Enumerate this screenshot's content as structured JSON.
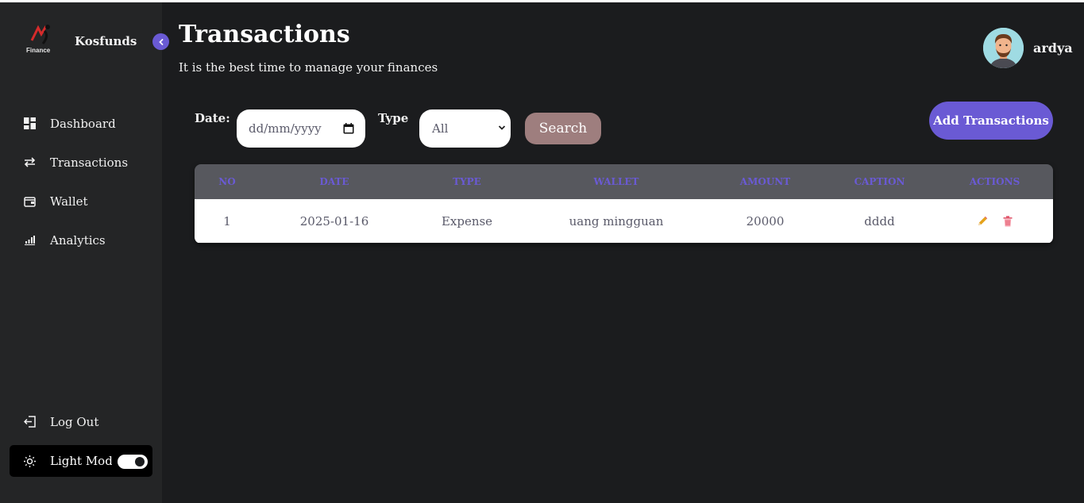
{
  "sidebar": {
    "logo_text": "Finance",
    "brand": "Kosfunds",
    "items": [
      {
        "label": "Dashboard",
        "icon": "dashboard-icon"
      },
      {
        "label": "Transactions",
        "icon": "transfer-arrows-icon"
      },
      {
        "label": "Wallet",
        "icon": "wallet-icon"
      },
      {
        "label": "Analytics",
        "icon": "bar-chart-icon"
      }
    ],
    "logout": "Log Out",
    "mode_label": "Light Mode",
    "mode_toggle_on": true
  },
  "header": {
    "title": "Transactions",
    "subtitle": "It is the best time to manage your finances"
  },
  "user": {
    "name": "ardya"
  },
  "filters": {
    "date_label": "Date:",
    "date_placeholder": "dd/mm/yyyy",
    "type_label": "Type",
    "type_value": "All",
    "search_label": "Search"
  },
  "add_button": "Add Transactions",
  "table": {
    "headers": [
      "No",
      "Date",
      "Type",
      "Wallet",
      "Amount",
      "Caption",
      "Actions"
    ],
    "rows": [
      {
        "no": "1",
        "date": "2025-01-16",
        "type": "Expense",
        "wallet": "uang mingguan",
        "amount": "20000",
        "caption": "dddd"
      }
    ]
  },
  "colors": {
    "accent": "#6a5ad4",
    "background": "#1b1c1e",
    "sidebar": "#242526",
    "search_button": "#9e7e7e",
    "delete_icon": "#e0566b",
    "edit_icon": "#e5a21b"
  }
}
